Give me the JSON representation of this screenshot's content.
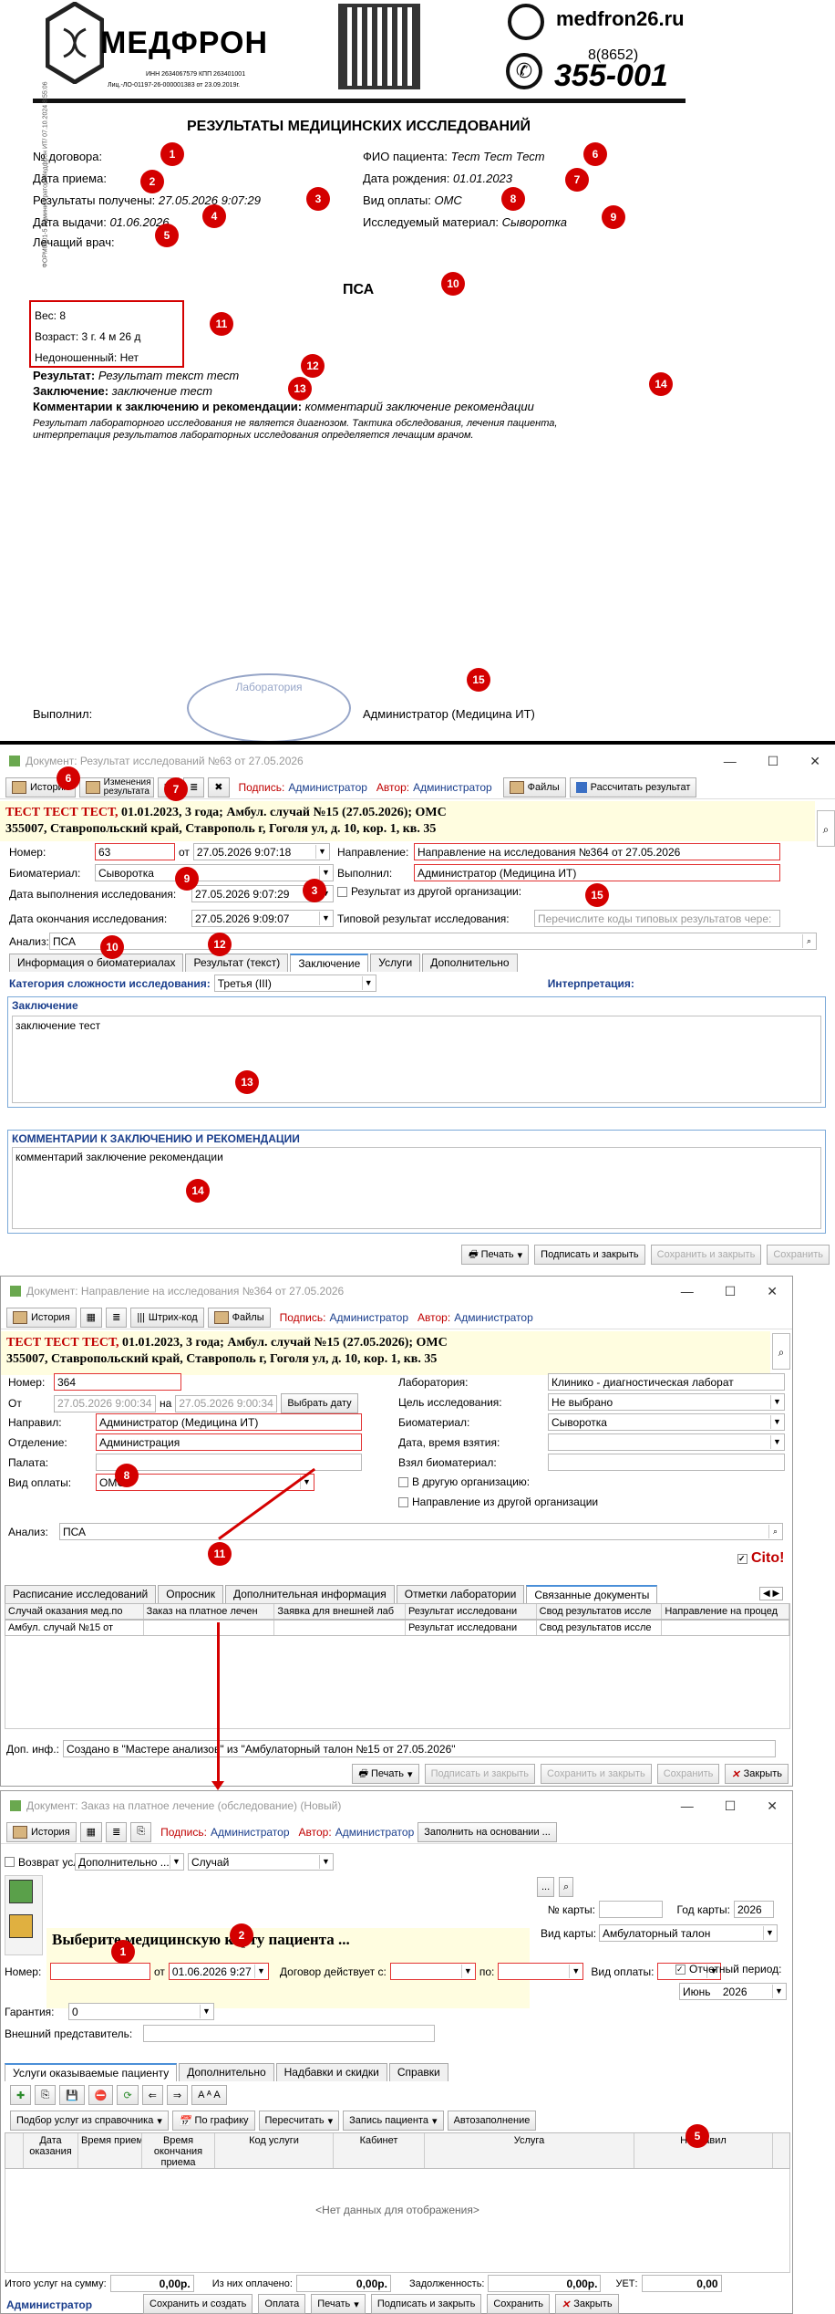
{
  "report": {
    "brand": "МЕДФРОН",
    "reg1": "ИНН 2634067579 КПП 263401001",
    "reg2": "Лиц.-ЛО-01197-26-000001383 от 23.09.2019г.",
    "site": "medfron26.ru",
    "phone_code": "8(8652)",
    "phone": "355-001",
    "side": "ФОРМ0001-5 Администратор/Медфрон  ИТ/ 07.10.2024 8:55:06",
    "title": "РЕЗУЛЬТАТЫ МЕДИЦИНСКИХ ИССЛЕДОВАНИЙ",
    "contract_label": "№ договора:",
    "adm_label": "Дата приема:",
    "received_label": "Результаты получены:",
    "received_val": "27.05.2026 9:07:29",
    "issue_label": "Дата выдачи:",
    "issue_val": "01.06.2026",
    "doctor_label": "Лечащий врач:",
    "fio_label": "ФИО пациента:",
    "fio_val": "Тест Тест Тест",
    "dob_label": "Дата рождения:",
    "dob_val": "01.01.2023",
    "pay_label": "Вид оплаты:",
    "pay_val": "ОМС",
    "material_label": "Исследуемый материал:",
    "material_val": "Сыворотка",
    "analysis": "ПСА",
    "weight": "Вес: 8",
    "age": "Возраст: 3 г. 4 м 26 д",
    "premature": "Недоношенный: Нет",
    "result_label": "Результат:",
    "result_val": "Результат текст тест",
    "concl_label": "Заключение:",
    "concl_val": "заключение тест",
    "comm_label": "Комментарии к заключению и рекомендации:",
    "comm_val": "комментарий заключение рекомендации",
    "disclaimer": "Результат лабораторного исследования не является диагнозом. Тактика обследования, лечения пациента, интерпретация результатов лабораторных исследования определяется лечащим врачом.",
    "performed_label": "Выполнил:",
    "performed_val": "Администратор (Медицина ИТ)",
    "stamp": "Лаборатория"
  },
  "w1": {
    "title": "Документ: Результат исследований №63 от 27.05.2026",
    "history": "История",
    "changes": "Изменения результата",
    "sign_l": "Подпись:",
    "sign_v": "Администратор",
    "author_l": "Автор:",
    "author_v": "Администратор",
    "files": "Файлы",
    "calc": "Рассчитать результат",
    "patient": "ТЕСТ ТЕСТ ТЕСТ,",
    "patient_rest": " 01.01.2023, 3 года; Амбул. случай №15 (27.05.2026); ОМС",
    "address": "355007, Ставропольский край, Ставрополь г, Гоголя ул, д. 10, кор. 1, кв. 35",
    "num_l": "Номер:",
    "num_v": "63",
    "from": "от",
    "date_v": "27.05.2026 9:07:18",
    "bio_l": "Биоматериал:",
    "bio_v": "Сыворотка",
    "exec_date_l": "Дата выполнения исследования:",
    "exec_date_v": "27.05.2026 9:07:29",
    "end_date_l": "Дата окончания исследования:",
    "end_date_v": "27.05.2026 9:09:07",
    "dir_l": "Направление:",
    "dir_v": "Направление на исследования №364 от 27.05.2026",
    "exec_l": "Выполнил:",
    "exec_v": "Администратор (Медицина ИТ)",
    "other_org": "Результат из другой организации:",
    "typical_l": "Типовой результат исследования:",
    "typical_ph": "Перечислите коды типовых результатов чере:",
    "analysis_l": "Анализ:",
    "analysis_v": "ПСА",
    "tabs": [
      "Информация о биоматериалах",
      "Результат (текст)",
      "Заключение",
      "Услуги",
      "Дополнительно"
    ],
    "complexity_l": "Категория сложности исследования:",
    "complexity_v": "Третья (III)",
    "interp": "Интерпретация:",
    "concl_title": "Заключение",
    "concl_text": "заключение тест",
    "comm_title": "КОММЕНТАРИИ К ЗАКЛЮЧЕНИЮ И РЕКОМЕНДАЦИИ",
    "comm_text": "комментарий заключение рекомендации",
    "print": "Печать",
    "sign_close": "Подписать и закрыть",
    "save_close": "Сохранить и закрыть",
    "save": "Сохранить"
  },
  "w2": {
    "title": "Документ: Направление на исследования №364 от 27.05.2026",
    "history": "История",
    "barcode": "Штрих-код",
    "files": "Файлы",
    "sign_l": "Подпись:",
    "sign_v": "Администратор",
    "author_l": "Автор:",
    "author_v": "Администратор",
    "patient": "ТЕСТ ТЕСТ ТЕСТ,",
    "patient_rest": " 01.01.2023, 3 года; Амбул. случай №15 (27.05.2026); ОМС",
    "address": "355007, Ставропольский край, Ставрополь г, Гоголя ул, д. 10, кор. 1, кв. 35",
    "num_l": "Номер:",
    "num_v": "364",
    "from_l": "От",
    "from_v": "27.05.2026 9:00:34",
    "to_l": "на",
    "to_v": "27.05.2026 9:00:34",
    "pick_date": "Выбрать дату",
    "sent_l": "Направил:",
    "sent_v": "Администратор (Медицина ИТ)",
    "dept_l": "Отделение:",
    "dept_v": "Администрация",
    "ward_l": "Палата:",
    "pay_l": "Вид оплаты:",
    "pay_v": "ОМС",
    "lab_l": "Лаборатория:",
    "lab_v": "Клинико - диагностическая лаборат",
    "goal_l": "Цель исследования:",
    "goal_v": "Не выбрано",
    "bio_l": "Биоматериал:",
    "bio_v": "Сыворотка",
    "take_l": "Дата, время взятия:",
    "took_l": "Взял биоматериал:",
    "other_org": "В другую организацию:",
    "from_org": "Направление из другой организации",
    "analysis_l": "Анализ:",
    "analysis_v": "ПСА",
    "cito": "Cito!",
    "tabs": [
      "Расписание исследований",
      "Опросник",
      "Дополнительная информация",
      "Отметки лаборатории",
      "Связанные документы"
    ],
    "cols": [
      "Случай оказания мед.по",
      "Заказ на платное лечен",
      "Заявка для внешней лаб",
      "Результат исследовани",
      "Свод результатов иссле",
      "Направление на процед"
    ],
    "row": [
      "Амбул. случай №15 от",
      "",
      "",
      "Результат исследовани",
      "Свод результатов иссле",
      ""
    ],
    "extra_l": "Доп. инф.:",
    "extra_v": "Создано в \"Мастере анализов\" из \"Амбулаторный талон №15 от 27.05.2026\"",
    "print": "Печать",
    "sign_close": "Подписать и закрыть",
    "save_close": "Сохранить и закрыть",
    "save": "Сохранить",
    "close": "Закрыть"
  },
  "w3": {
    "title": "Документ: Заказ на платное лечение (обследование) (Новый)",
    "history": "История",
    "sign_l": "Подпись:",
    "sign_v": "Администратор",
    "author_l": "Автор:",
    "author_v": "Администратор",
    "fill": "Заполнить на основании ...",
    "return_l": "Возврат услуг",
    "extra": "Дополнительно ...",
    "case": "Случай",
    "choose": "Выберите медицинскую карту пациента ...",
    "card_num_l": "№ карты:",
    "card_year_l": "Год карты:",
    "card_year_v": "2026",
    "card_kind_l": "Вид карты:",
    "card_kind_v": "Амбулаторный талон",
    "num_l": "Номер:",
    "from_l": "от",
    "from_v": "01.06.2026 9:27",
    "valid_l": "Договор действует с:",
    "to_l": "по:",
    "pay_l": "Вид оплаты:",
    "report_l": "Отчетный период:",
    "period_v": "Июнь",
    "period_y": "2026",
    "guarantee_l": "Гарантия:",
    "guarantee_v": "0",
    "rep_l": "Внешний представитель:",
    "tabs": [
      "Услуги оказываемые пациенту",
      "Дополнительно",
      "Надбавки и скидки",
      "Справки"
    ],
    "pick": "Подбор услуг из справочника",
    "sched": "По графику",
    "recalc": "Пересчитать",
    "rec": "Запись пациента",
    "auto": "Автозаполнение",
    "cols": [
      "Дата оказания",
      "Время приема",
      "Время окончания приема",
      "Код услуги",
      "Кабинет",
      "Услуга",
      "Направил"
    ],
    "empty": "<Нет данных для отображения>",
    "total_l": "Итого услуг на сумму:",
    "total_v": "0,00р.",
    "paid_l": "Из них оплачено:",
    "paid_v": "0,00р.",
    "debt_l": "Задолженность:",
    "debt_v": "0,00р.",
    "uet_l": "УЕТ:",
    "uet_v": "0,00",
    "status": "Администратор",
    "save_create": "Сохранить и создать",
    "pay": "Оплата",
    "print": "Печать",
    "sign_close": "Подписать и закрыть",
    "save": "Сохранить",
    "close": "Закрыть"
  },
  "markers": [
    "1",
    "2",
    "3",
    "4",
    "5",
    "6",
    "7",
    "8",
    "9",
    "10",
    "11",
    "12",
    "13",
    "14",
    "15"
  ],
  "colors": {
    "marker": "#d40000",
    "accent": "#1a3e8c",
    "header_bg": "#fffde0"
  }
}
